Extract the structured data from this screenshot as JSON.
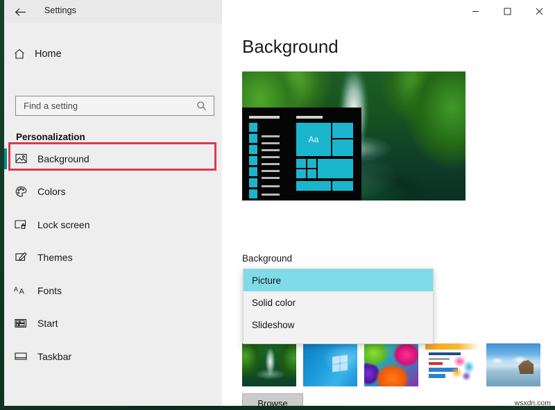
{
  "window": {
    "title": "Settings",
    "back_icon": "back-arrow-icon",
    "controls": {
      "minimize": "─",
      "maximize": "□",
      "close": "✕"
    }
  },
  "sidebar": {
    "home": {
      "label": "Home",
      "icon": "home-icon"
    },
    "search": {
      "placeholder": "Find a setting",
      "value": "",
      "icon": "search-icon"
    },
    "section_title": "Personalization",
    "items": [
      {
        "label": "Background",
        "icon": "picture-icon",
        "active": true
      },
      {
        "label": "Colors",
        "icon": "palette-icon",
        "active": false
      },
      {
        "label": "Lock screen",
        "icon": "lock-screen-icon",
        "active": false
      },
      {
        "label": "Themes",
        "icon": "themes-brush-icon",
        "active": false
      },
      {
        "label": "Fonts",
        "icon": "fonts-aa-icon",
        "active": false
      },
      {
        "label": "Start",
        "icon": "start-tiles-icon",
        "active": false
      },
      {
        "label": "Taskbar",
        "icon": "taskbar-icon",
        "active": false
      }
    ]
  },
  "main": {
    "page_title": "Background",
    "preview": {
      "name": "desktop-preview",
      "start_menu_tile_text": "Aa"
    },
    "background_field": {
      "label": "Background",
      "selected": "Picture",
      "options": [
        "Picture",
        "Solid color",
        "Slideshow"
      ]
    },
    "thumbnails": [
      {
        "name": "thumbnail-waterfall"
      },
      {
        "name": "thumbnail-windows-blue"
      },
      {
        "name": "thumbnail-umbrellas"
      },
      {
        "name": "thumbnail-ad-magicbook"
      },
      {
        "name": "thumbnail-beach-rock"
      }
    ],
    "browse_label": "Browse"
  },
  "watermark": "wsxdn.com",
  "colors": {
    "accent_teal": "#008f8f",
    "highlight": "#7fdbe8",
    "annotation_red": "#d83a4e",
    "sidebar_bg": "#eeeeee",
    "tile_cyan": "#1bb6cd"
  }
}
